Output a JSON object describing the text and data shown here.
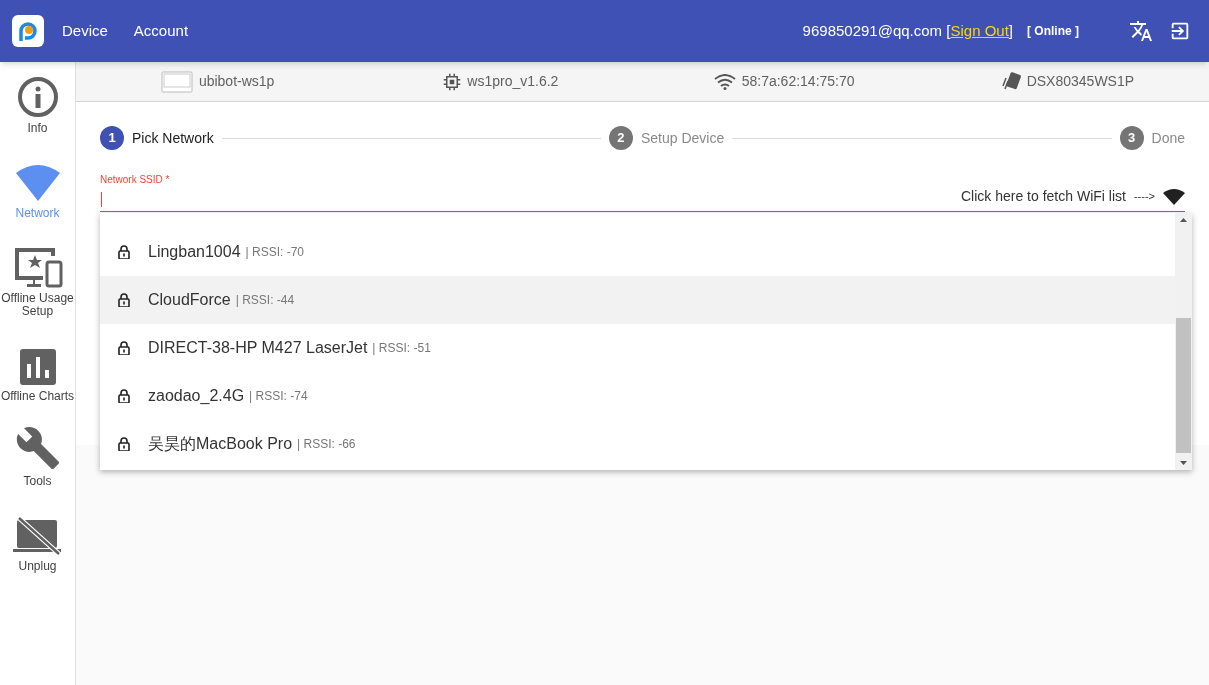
{
  "header": {
    "nav": [
      "Device",
      "Account"
    ],
    "email": "969850291@qq.com",
    "open_bracket": "[",
    "close_bracket": "]",
    "sign_out": "Sign Out",
    "status": "[ Online ]"
  },
  "sidebar": {
    "items": [
      {
        "kind": "info",
        "label": "Info",
        "selected": false
      },
      {
        "kind": "network",
        "label": "Network",
        "selected": true
      },
      {
        "kind": "offline",
        "label": "Offline Usage Setup",
        "selected": false
      },
      {
        "kind": "charts",
        "label": "Offline Charts",
        "selected": false
      },
      {
        "kind": "tools",
        "label": "Tools",
        "selected": false
      },
      {
        "kind": "unplug",
        "label": "Unplug",
        "selected": false
      }
    ]
  },
  "device_bar": [
    {
      "kind": "device",
      "text": "ubibot-ws1p"
    },
    {
      "kind": "chip",
      "text": "ws1pro_v1.6.2"
    },
    {
      "kind": "wifi",
      "text": "58:7a:62:14:75:70"
    },
    {
      "kind": "card",
      "text": "DSX80345WS1P"
    }
  ],
  "stepper": [
    {
      "number": "1",
      "label": "Pick Network",
      "active": true
    },
    {
      "number": "2",
      "label": "Setup Device",
      "active": false
    },
    {
      "number": "3",
      "label": "Done",
      "active": false
    }
  ],
  "ssid_field": {
    "label": "Network SSID *",
    "fetch_hint": "Click here to fetch WiFi list",
    "arrow": "---->"
  },
  "networks": [
    {
      "name": "Lingban1004",
      "rssi": "| RSSI: -70",
      "selected": false
    },
    {
      "name": "CloudForce",
      "rssi": "| RSSI: -44",
      "selected": true
    },
    {
      "name": "DIRECT-38-HP M427 LaserJet",
      "rssi": "| RSSI: -51",
      "selected": false
    },
    {
      "name": "zaodao_2.4G",
      "rssi": "| RSSI: -74",
      "selected": false
    },
    {
      "name": "吴昊的MacBook Pro",
      "rssi": "| RSSI: -66",
      "selected": false
    }
  ]
}
